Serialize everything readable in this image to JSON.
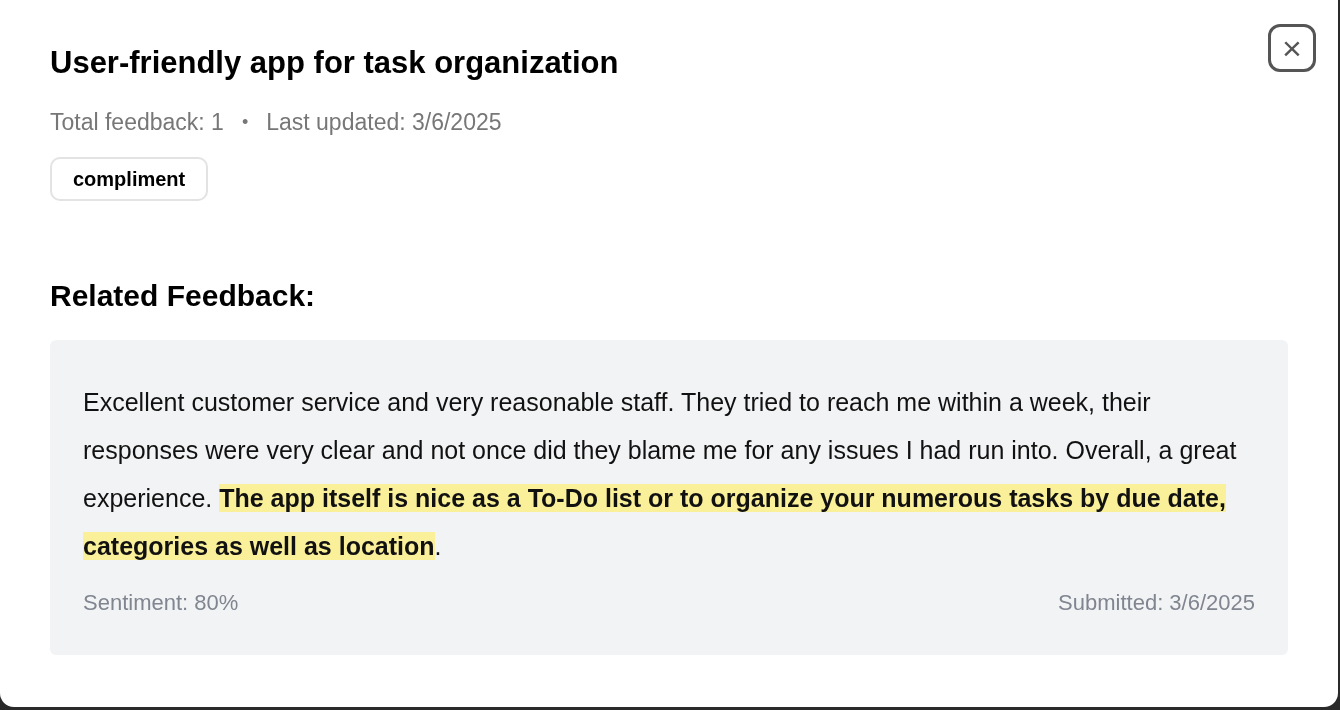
{
  "dialog": {
    "title": "User-friendly app for task organization",
    "meta": {
      "total": "Total feedback: 1",
      "separator": "•",
      "updated": "Last updated: 3/6/2025"
    },
    "tags": [
      "compliment"
    ],
    "close_button": "×"
  },
  "related": {
    "heading": "Related Feedback:",
    "items": [
      {
        "segments": [
          {
            "text": "Excellent customer service and very reasonable staff. They tried to reach me within a week, their responses were very clear and not once did they blame me for any issues I had run into. Overall, a great experience. ",
            "highlighted": false
          },
          {
            "text": "The app itself is nice as a To-Do list or to organize your numerous tasks by due date, categories as well as location",
            "highlighted": true
          },
          {
            "text": ".",
            "highlighted": false
          }
        ],
        "sentiment": "Sentiment: 80%",
        "submitted": "Submitted: 3/6/2025"
      }
    ]
  }
}
